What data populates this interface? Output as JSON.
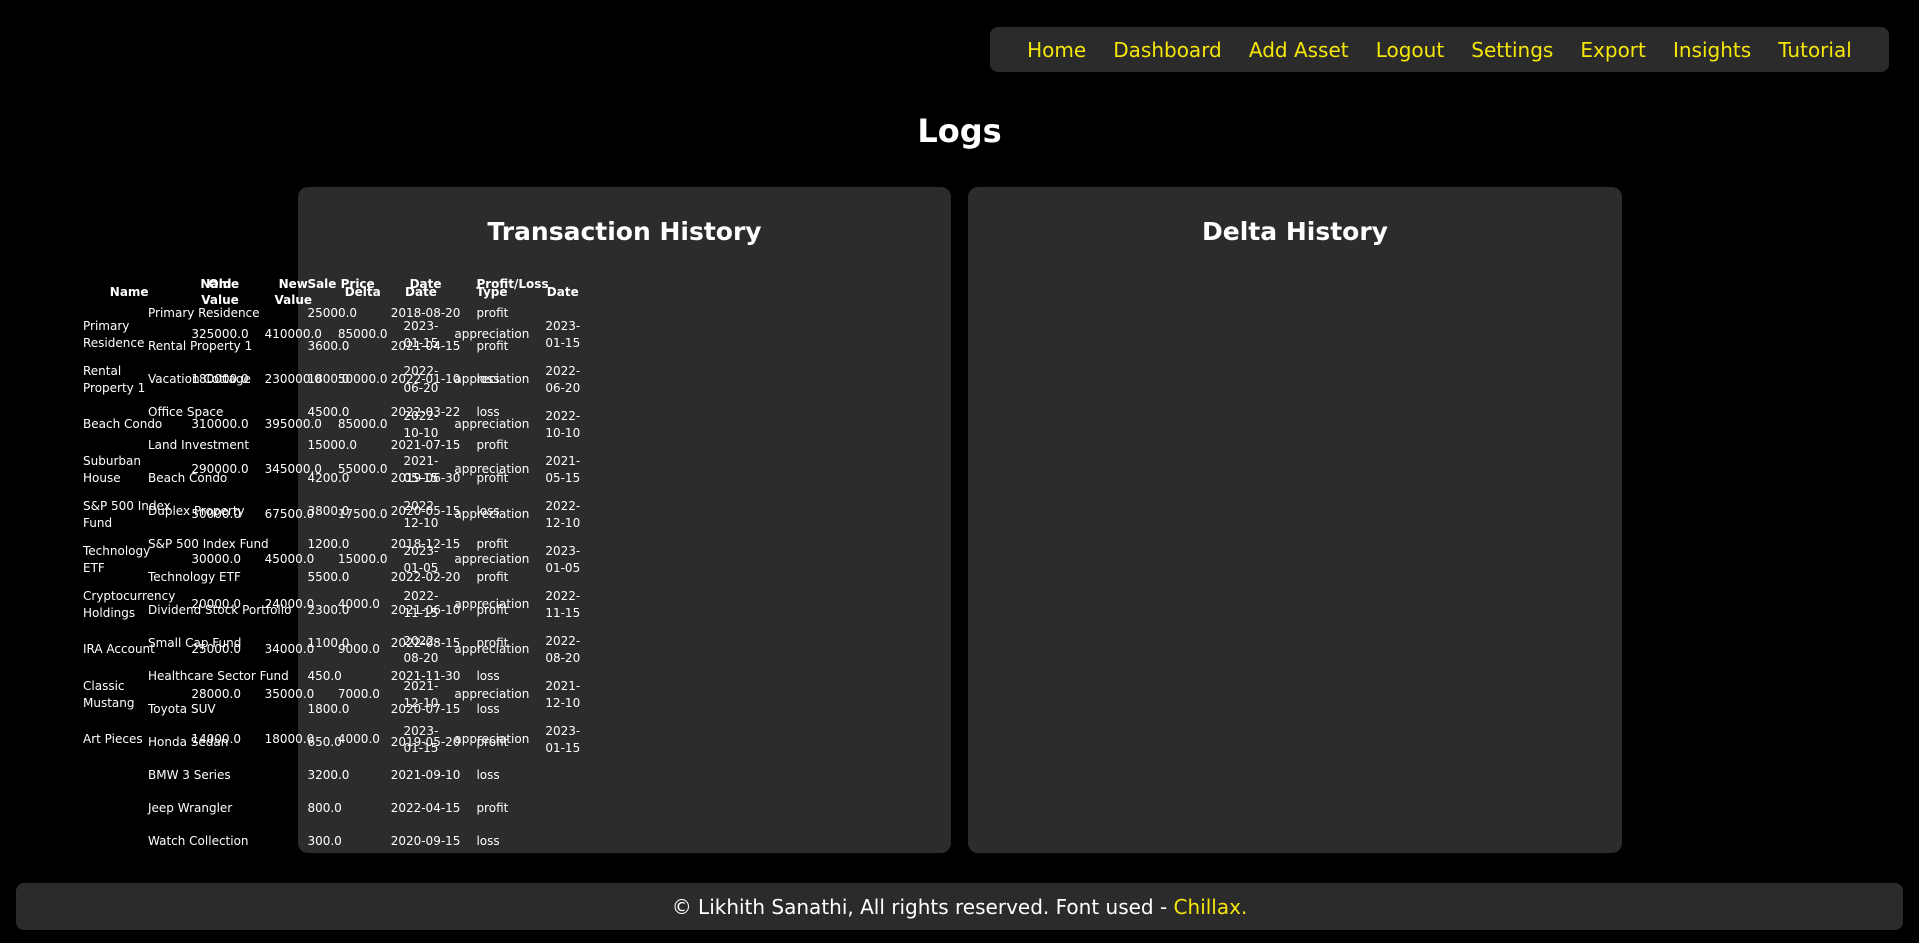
{
  "nav": {
    "links": [
      "Home",
      "Dashboard",
      "Add Asset",
      "Logout",
      "Settings",
      "Export",
      "Insights",
      "Tutorial"
    ]
  },
  "page": {
    "title": "Logs"
  },
  "transaction": {
    "title": "Transaction History",
    "headers": [
      "Name",
      "Sale Price",
      "Date",
      "Profit/Loss"
    ],
    "rows": [
      [
        "Primary Residence",
        "25000.0",
        "2018-08-20",
        "profit"
      ],
      [
        "Rental Property 1",
        "3600.0",
        "2021-04-15",
        "profit"
      ],
      [
        "Vacation Cottage",
        "1800.0",
        "2022-01-10",
        "loss"
      ],
      [
        "Office Space",
        "4500.0",
        "2022-03-22",
        "loss"
      ],
      [
        "Land Investment",
        "15000.0",
        "2021-07-15",
        "profit"
      ],
      [
        "Beach Condo",
        "4200.0",
        "2019-06-30",
        "profit"
      ],
      [
        "Duplex Property",
        "3800.0",
        "2020-05-15",
        "loss"
      ],
      [
        "S&P 500 Index Fund",
        "1200.0",
        "2018-12-15",
        "profit"
      ],
      [
        "Technology ETF",
        "5500.0",
        "2022-02-20",
        "profit"
      ],
      [
        "Dividend Stock Portfolio",
        "2300.0",
        "2021-06-10",
        "profit"
      ],
      [
        "Small Cap Fund",
        "1100.0",
        "2022-08-15",
        "profit"
      ],
      [
        "Healthcare Sector Fund",
        "450.0",
        "2021-11-30",
        "loss"
      ],
      [
        "Toyota SUV",
        "1800.0",
        "2020-07-15",
        "loss"
      ],
      [
        "Honda Sedan",
        "650.0",
        "2019-05-20",
        "profit"
      ],
      [
        "BMW 3 Series",
        "3200.0",
        "2021-09-10",
        "loss"
      ],
      [
        "Jeep Wrangler",
        "800.0",
        "2022-04-15",
        "profit"
      ],
      [
        "Watch Collection",
        "300.0",
        "2020-09-15",
        "loss"
      ]
    ]
  },
  "delta": {
    "title": "Delta History",
    "headers": [
      "Name",
      "Old Value",
      "New Value",
      "Delta",
      "Date",
      "Type",
      "Date"
    ],
    "rows": [
      [
        "Primary Residence",
        "325000.0",
        "410000.0",
        "85000.0",
        "2023-01-15",
        "appreciation",
        "2023-01-15"
      ],
      [
        "Rental Property 1",
        "180000.0",
        "230000.0",
        "50000.0",
        "2022-06-20",
        "appreciation",
        "2022-06-20"
      ],
      [
        "Beach Condo",
        "310000.0",
        "395000.0",
        "85000.0",
        "2022-10-10",
        "appreciation",
        "2022-10-10"
      ],
      [
        "Suburban House",
        "290000.0",
        "345000.0",
        "55000.0",
        "2021-05-15",
        "appreciation",
        "2021-05-15"
      ],
      [
        "S&P 500 Index Fund",
        "50000.0",
        "67500.0",
        "17500.0",
        "2022-12-10",
        "appreciation",
        "2022-12-10"
      ],
      [
        "Technology ETF",
        "30000.0",
        "45000.0",
        "15000.0",
        "2023-01-05",
        "appreciation",
        "2023-01-05"
      ],
      [
        "Cryptocurrency Holdings",
        "20000.0",
        "24000.0",
        "4000.0",
        "2022-11-15",
        "appreciation",
        "2022-11-15"
      ],
      [
        "IRA Account",
        "25000.0",
        "34000.0",
        "9000.0",
        "2022-08-20",
        "appreciation",
        "2022-08-20"
      ],
      [
        "Classic Mustang",
        "28000.0",
        "35000.0",
        "7000.0",
        "2021-12-10",
        "appreciation",
        "2021-12-10"
      ],
      [
        "Art Pieces",
        "14000.0",
        "18000.0",
        "4000.0",
        "2023-01-15",
        "appreciation",
        "2023-01-15"
      ]
    ]
  },
  "footer": {
    "text": "© Likhith Sanathi, All rights reserved. Font used - ",
    "font_link": "Chillax."
  },
  "colors": {
    "accent": "#f5e60a",
    "panel": "#2c2c2c",
    "background": "#000000"
  }
}
